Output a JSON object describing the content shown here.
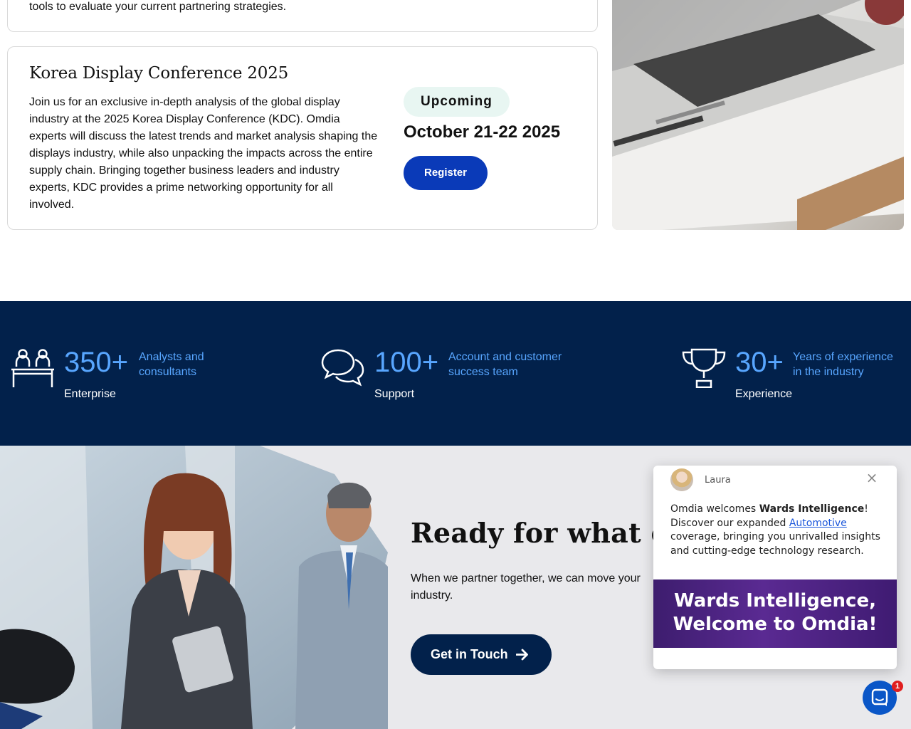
{
  "partnering_card": {
    "text": "tools to evaluate your current partnering strategies."
  },
  "event": {
    "title": "Korea Display Conference 2025",
    "description": "Join us for an exclusive in-depth analysis of the global display industry at the 2025 Korea Display Conference (KDC). Omdia experts will discuss the latest trends and market analysis shaping the displays industry, while also unpacking the impacts across the entire supply chain. Bringing together business leaders and industry experts, KDC provides a prime networking opportunity for all involved.",
    "status": "Upcoming",
    "date": "October 21-22 2025",
    "register_label": "Register"
  },
  "stats": [
    {
      "icon": "people-at-desk-icon",
      "number": "350+",
      "desc_line1": "Analysts and",
      "desc_line2": "consultants",
      "label": "Enterprise"
    },
    {
      "icon": "speech-bubbles-icon",
      "number": "100+",
      "desc_line1": "Account and customer",
      "desc_line2": "success team",
      "label": "Support"
    },
    {
      "icon": "trophy-icon",
      "number": "30+",
      "desc_line1": "Years of experience",
      "desc_line2": "in the industry",
      "label": "Experience"
    }
  ],
  "cta": {
    "title": "Ready for what co",
    "text_line1": "When we partner together, we can move your",
    "text_line2": "industry.",
    "button_label": "Get in Touch"
  },
  "chat": {
    "agent_name": "Laura",
    "msg_part1": "Omdia welcomes ",
    "msg_bold": "Wards Intelligence",
    "msg_part2": "! Discover our expanded ",
    "msg_link": "Automotive",
    "msg_part3": " coverage, bringing you unrivalled insights and cutting-edge technology research.",
    "banner_line1": "Wards Intelligence,",
    "banner_line2": "Welcome to Omdia!",
    "close_symbol": "×",
    "unread_count": "1"
  },
  "colors": {
    "navy": "#02214b",
    "stat_blue": "#58a6ff",
    "register_blue": "#0a3ab8",
    "badge_bg": "#e8f6f2",
    "banner_purple": "#5a2a92"
  }
}
